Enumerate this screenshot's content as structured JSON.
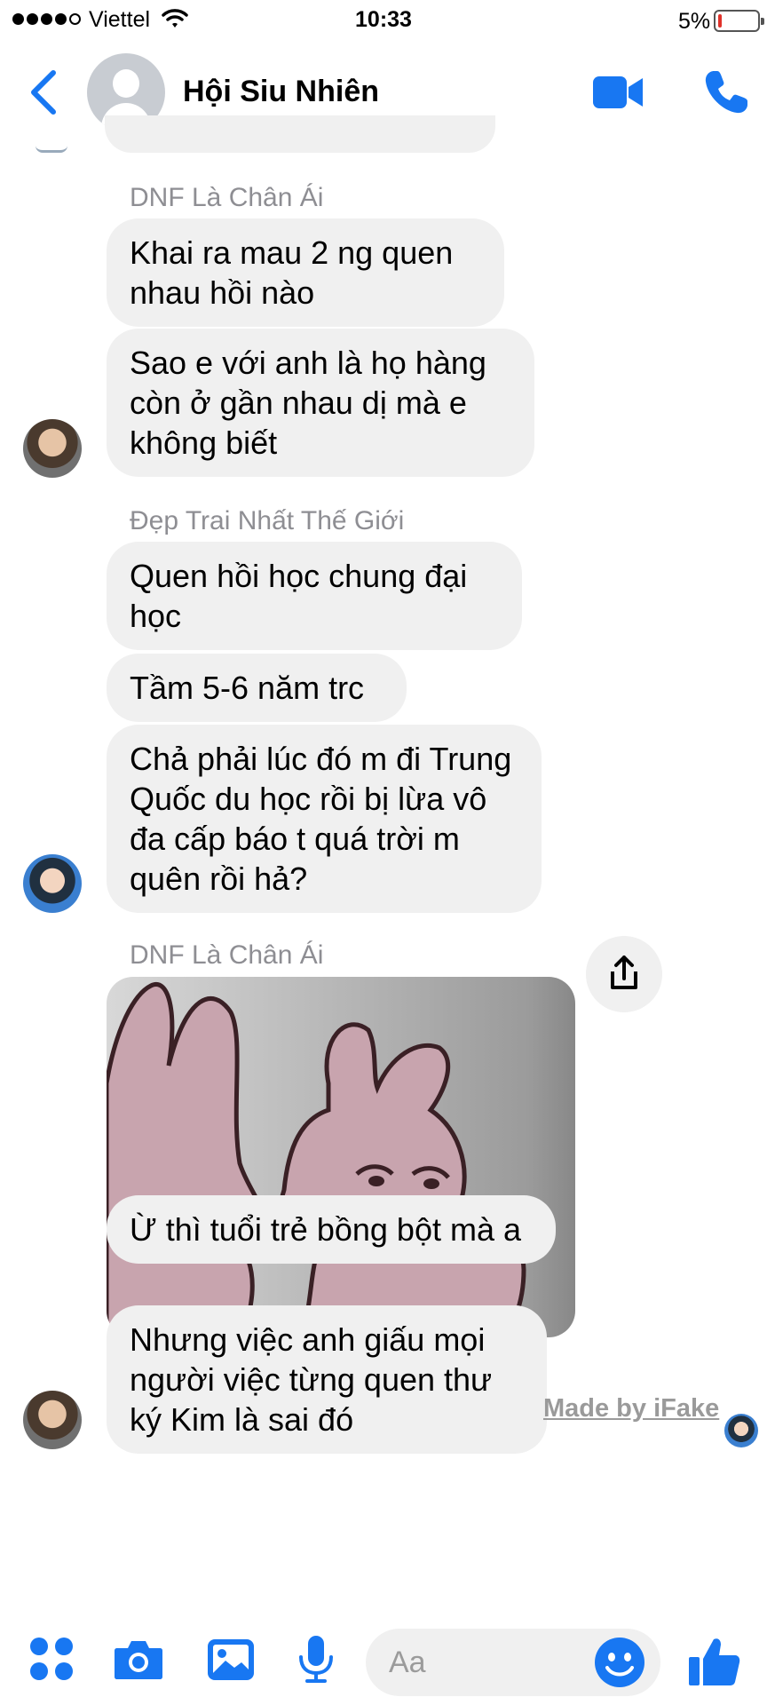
{
  "status_bar": {
    "carrier": "Viettel",
    "time": "10:33",
    "battery": "5%",
    "battery_level": 0.05
  },
  "header": {
    "title": "Hội Siu Nhiên",
    "back_icon": "chevron-left-icon",
    "video_icon": "video-camera-icon",
    "call_icon": "phone-icon",
    "accent": "#1877f2"
  },
  "messages": {
    "group1": {
      "sender": "DNF Là Chân Ái",
      "bubbles": [
        "Khai ra mau 2 ng quen nhau hồi nào",
        "Sao e với anh là họ hàng còn ở gần nhau dị mà e không biết"
      ]
    },
    "group2": {
      "sender": "Đẹp Trai Nhất Thế Giới",
      "bubbles": [
        "Quen hồi học chung đại học",
        "Tầm 5-6 năm trc",
        "Chả phải lúc đó m đi Trung Quốc du học rồi bị lừa vô đa cấp báo t quá trời m quên rồi hả?"
      ]
    },
    "group3": {
      "sender": "DNF Là Chân Ái",
      "image": "pink-bunny-meme-sticker",
      "bubbles": [
        "Ừ thì tuổi trẻ bồng bột mà a",
        "Nhưng việc anh giấu mọi người việc từng quen thư ký Kim là sai đó"
      ]
    }
  },
  "watermark": "Made by iFake",
  "composer": {
    "placeholder": "Aa",
    "icons": [
      "apps-icon",
      "camera-icon",
      "image-icon",
      "microphone-icon",
      "emoji-icon",
      "thumbs-up-icon"
    ]
  }
}
